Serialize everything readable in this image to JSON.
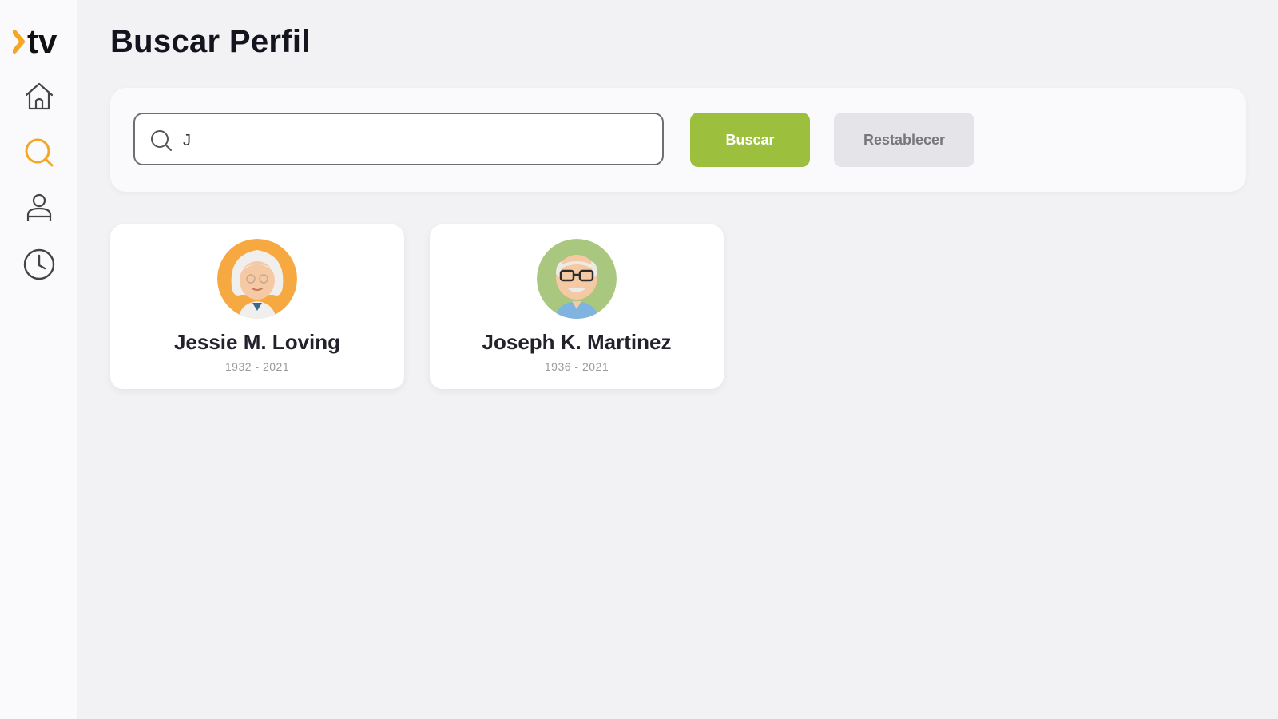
{
  "app": {
    "logo_text": "›tv",
    "accent_color": "#f5a623",
    "brand_green": "#9cbf3e"
  },
  "sidebar": {
    "items": [
      {
        "name": "home",
        "icon": "home-icon",
        "active": false
      },
      {
        "name": "search",
        "icon": "search-icon",
        "active": true
      },
      {
        "name": "profile",
        "icon": "user-icon",
        "active": false
      },
      {
        "name": "history",
        "icon": "clock-icon",
        "active": false
      }
    ]
  },
  "page": {
    "title": "Buscar Perfil"
  },
  "search": {
    "value": "J",
    "search_label": "Buscar",
    "reset_label": "Restablecer"
  },
  "results": [
    {
      "name": "Jessie M. Loving",
      "years": "1932 - 2021",
      "avatar_bg": "#f7a941"
    },
    {
      "name": "Joseph K. Martinez",
      "years": "1936 - 2021",
      "avatar_bg": "#a9c77e"
    }
  ]
}
